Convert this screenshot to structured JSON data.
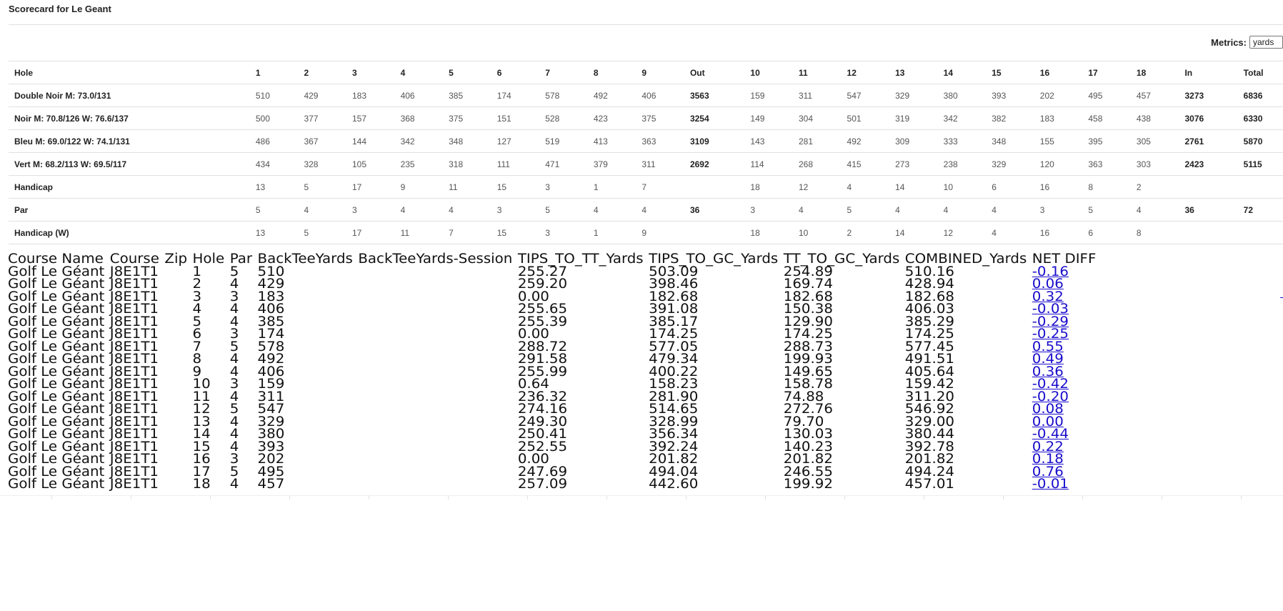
{
  "page": {
    "title": "Scorecard for Le Geant"
  },
  "metrics": {
    "label": "Metrics:",
    "selected": "yards"
  },
  "scorecard": {
    "header": [
      "Hole",
      "1",
      "2",
      "3",
      "4",
      "5",
      "6",
      "7",
      "8",
      "9",
      "Out",
      "10",
      "11",
      "12",
      "13",
      "14",
      "15",
      "16",
      "17",
      "18",
      "In",
      "Total"
    ],
    "rows": [
      {
        "label": "Double Noir M: 73.0/131",
        "cells": [
          "510",
          "429",
          "183",
          "406",
          "385",
          "174",
          "578",
          "492",
          "406",
          "3563",
          "159",
          "311",
          "547",
          "329",
          "380",
          "393",
          "202",
          "495",
          "457",
          "3273",
          "6836"
        ]
      },
      {
        "label": "Noir M: 70.8/126 W: 76.6/137",
        "cells": [
          "500",
          "377",
          "157",
          "368",
          "375",
          "151",
          "528",
          "423",
          "375",
          "3254",
          "149",
          "304",
          "501",
          "319",
          "342",
          "382",
          "183",
          "458",
          "438",
          "3076",
          "6330"
        ]
      },
      {
        "label": "Bleu M: 69.0/122 W: 74.1/131",
        "cells": [
          "486",
          "367",
          "144",
          "342",
          "348",
          "127",
          "519",
          "413",
          "363",
          "3109",
          "143",
          "281",
          "492",
          "309",
          "333",
          "348",
          "155",
          "395",
          "305",
          "2761",
          "5870"
        ]
      },
      {
        "label": "Vert M: 68.2/113 W: 69.5/117",
        "cells": [
          "434",
          "328",
          "105",
          "235",
          "318",
          "111",
          "471",
          "379",
          "311",
          "2692",
          "114",
          "268",
          "415",
          "273",
          "238",
          "329",
          "120",
          "363",
          "303",
          "2423",
          "5115"
        ]
      },
      {
        "label": "Handicap",
        "cells": [
          "13",
          "5",
          "17",
          "9",
          "11",
          "15",
          "3",
          "1",
          "7",
          "",
          "18",
          "12",
          "4",
          "14",
          "10",
          "6",
          "16",
          "8",
          "2",
          "",
          ""
        ]
      },
      {
        "label": "Par",
        "cells": [
          "5",
          "4",
          "3",
          "4",
          "4",
          "3",
          "5",
          "4",
          "4",
          "36",
          "3",
          "4",
          "5",
          "4",
          "4",
          "4",
          "3",
          "5",
          "4",
          "36",
          "72"
        ]
      },
      {
        "label": "Handicap (W)",
        "cells": [
          "13",
          "5",
          "17",
          "11",
          "7",
          "15",
          "3",
          "1",
          "9",
          "",
          "18",
          "10",
          "2",
          "14",
          "12",
          "4",
          "16",
          "6",
          "8",
          "",
          ""
        ]
      }
    ]
  },
  "data_table": {
    "columns": [
      "Course Name",
      "Course",
      "Zip",
      "Hole",
      "Par",
      "BackTeeYards",
      "BackTeeYards-Session",
      "TIPS_TO_TT_Yards",
      "TIPS_TO_GC_Yards",
      "TT_TO_GC_Yards",
      "COMBINED_Yards",
      "NET DIFF"
    ],
    "rows": [
      [
        "Golf Le Géant",
        "J8E1T1",
        "",
        "1",
        "5",
        "510",
        "",
        "255.27",
        "503.09",
        "254.89",
        "510.16",
        "-0.16"
      ],
      [
        "Golf Le Géant",
        "J8E1T1",
        "",
        "2",
        "4",
        "429",
        "",
        "259.20",
        "398.46",
        "169.74",
        "428.94",
        "0.06"
      ],
      [
        "Golf Le Géant",
        "J8E1T1",
        "",
        "3",
        "3",
        "183",
        "",
        "0.00",
        "182.68",
        "182.68",
        "182.68",
        "0.32"
      ],
      [
        "Golf Le Géant",
        "J8E1T1",
        "",
        "4",
        "4",
        "406",
        "",
        "255.65",
        "391.08",
        "150.38",
        "406.03",
        "-0.03"
      ],
      [
        "Golf Le Géant",
        "J8E1T1",
        "",
        "5",
        "4",
        "385",
        "",
        "255.39",
        "385.17",
        "129.90",
        "385.29",
        "-0.29"
      ],
      [
        "Golf Le Géant",
        "J8E1T1",
        "",
        "6",
        "3",
        "174",
        "",
        "0.00",
        "174.25",
        "174.25",
        "174.25",
        "-0.25"
      ],
      [
        "Golf Le Géant",
        "J8E1T1",
        "",
        "7",
        "5",
        "578",
        "",
        "288.72",
        "577.05",
        "288.73",
        "577.45",
        "0.55"
      ],
      [
        "Golf Le Géant",
        "J8E1T1",
        "",
        "8",
        "4",
        "492",
        "",
        "291.58",
        "479.34",
        "199.93",
        "491.51",
        "0.49"
      ],
      [
        "Golf Le Géant",
        "J8E1T1",
        "",
        "9",
        "4",
        "406",
        "",
        "255.99",
        "400.22",
        "149.65",
        "405.64",
        "0.36"
      ],
      [
        "Golf Le Géant",
        "J8E1T1",
        "",
        "10",
        "3",
        "159",
        "",
        "0.64",
        "158.23",
        "158.78",
        "159.42",
        "-0.42"
      ],
      [
        "Golf Le Géant",
        "J8E1T1",
        "",
        "11",
        "4",
        "311",
        "",
        "236.32",
        "281.90",
        "74.88",
        "311.20",
        "-0.20"
      ],
      [
        "Golf Le Géant",
        "J8E1T1",
        "",
        "12",
        "5",
        "547",
        "",
        "274.16",
        "514.65",
        "272.76",
        "546.92",
        "0.08"
      ],
      [
        "Golf Le Géant",
        "J8E1T1",
        "",
        "13",
        "4",
        "329",
        "",
        "249.30",
        "328.99",
        "79.70",
        "329.00",
        "0.00"
      ],
      [
        "Golf Le Géant",
        "J8E1T1",
        "",
        "14",
        "4",
        "380",
        "",
        "250.41",
        "356.34",
        "130.03",
        "380.44",
        "-0.44"
      ],
      [
        "Golf Le Géant",
        "J8E1T1",
        "",
        "15",
        "4",
        "393",
        "",
        "252.55",
        "392.24",
        "140.23",
        "392.78",
        "0.22"
      ],
      [
        "Golf Le Géant",
        "J8E1T1",
        "",
        "16",
        "3",
        "202",
        "",
        "0.00",
        "201.82",
        "201.82",
        "201.82",
        "0.18"
      ],
      [
        "Golf Le Géant",
        "J8E1T1",
        "",
        "17",
        "5",
        "495",
        "",
        "247.69",
        "494.04",
        "246.55",
        "494.24",
        "0.76"
      ],
      [
        "Golf Le Géant",
        "J8E1T1",
        "",
        "18",
        "4",
        "457",
        "",
        "257.09",
        "442.60",
        "199.92",
        "457.01",
        "-0.01"
      ]
    ]
  },
  "colors": {
    "link": "#1a0dcc",
    "rule": "#e0e0e0",
    "text": "#222222"
  }
}
